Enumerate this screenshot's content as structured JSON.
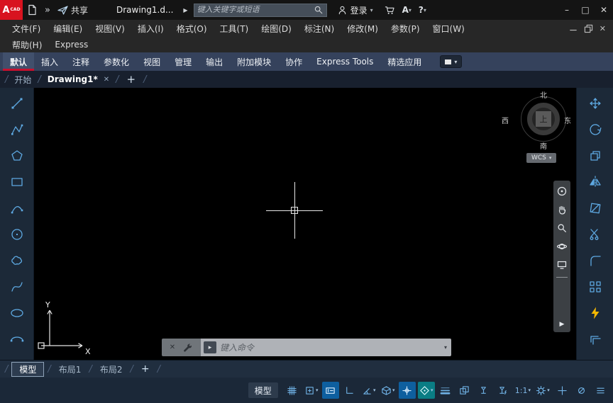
{
  "colors": {
    "accent_red": "#d8131f",
    "ribbon_bg": "#35425c",
    "toolbar_bg": "#1c2938",
    "icon_blue": "#5ea9e2",
    "toggle_active_blue": "#0e5f9f",
    "toggle_active_teal": "#0a7d84",
    "bolt_yellow": "#f5b800",
    "canvas_black": "#000000"
  },
  "icons": {
    "double_chevron": "»",
    "play_arrow": "▶",
    "dropdown": "▾",
    "close": "✕",
    "minimize": "–",
    "maximize": "□",
    "plus": "+",
    "slash": "/",
    "question": "?",
    "account_letter": "A",
    "prompt_chip": "▸"
  },
  "titlebar": {
    "logo_letter": "A",
    "logo_sub": "CAD",
    "share_label": "共享",
    "doc_title": "Drawing1.d...",
    "search_placeholder": "键入关键字或短语",
    "signin_label": "登录"
  },
  "menubar": {
    "items": [
      "文件(F)",
      "编辑(E)",
      "视图(V)",
      "插入(I)",
      "格式(O)",
      "工具(T)",
      "绘图(D)",
      "标注(N)",
      "修改(M)",
      "参数(P)",
      "窗口(W)"
    ],
    "row2_items": [
      "帮助(H)",
      "Express"
    ]
  },
  "ribbon": {
    "tabs": [
      "默认",
      "插入",
      "注释",
      "参数化",
      "视图",
      "管理",
      "输出",
      "附加模块",
      "协作",
      "Express Tools",
      "精选应用"
    ],
    "active_tab": "默认"
  },
  "doc_tabs": {
    "start_label": "开始",
    "drawing_label": "Drawing1*"
  },
  "viewcube": {
    "north": "北",
    "south": "南",
    "west": "西",
    "east": "东",
    "top": "上",
    "wcs_label": "WCS"
  },
  "navbar_icons": [
    "full-navigation-wheel",
    "pan-hand",
    "zoom-magnifier",
    "orbit",
    "showmotion-screen",
    "expand-play"
  ],
  "left_toolbar_icons": [
    "line",
    "polyline",
    "polygon",
    "rectangle",
    "arc",
    "circle",
    "revision-cloud",
    "spline",
    "ellipse",
    "ellipse-arc"
  ],
  "right_toolbar_icons": [
    "move",
    "rotate",
    "copy",
    "mirror",
    "erase",
    "trim",
    "fillet",
    "array",
    "lightning",
    "offset"
  ],
  "ucs": {
    "x_label": "X",
    "y_label": "Y"
  },
  "command_line": {
    "placeholder": "键入命令"
  },
  "layout_tabs": {
    "items": [
      "模型",
      "布局1",
      "布局2"
    ],
    "active": "模型"
  },
  "statusbar": {
    "model_label": "模型",
    "scale_label": "1:1",
    "icons": [
      "grid",
      "snap",
      "dynamic-input",
      "ortho",
      "polar-tracking",
      "isometric-drafting",
      "object-snap-tracking",
      "object-snap",
      "lineweight",
      "selection-cycling",
      "annotation-visibility",
      "annotation-autoscale",
      "annotation-scale",
      "settings-gear",
      "crosshair",
      "isolate-objects",
      "customize"
    ],
    "active_icons": [
      "dynamic-input",
      "object-snap-tracking",
      "object-snap"
    ]
  }
}
